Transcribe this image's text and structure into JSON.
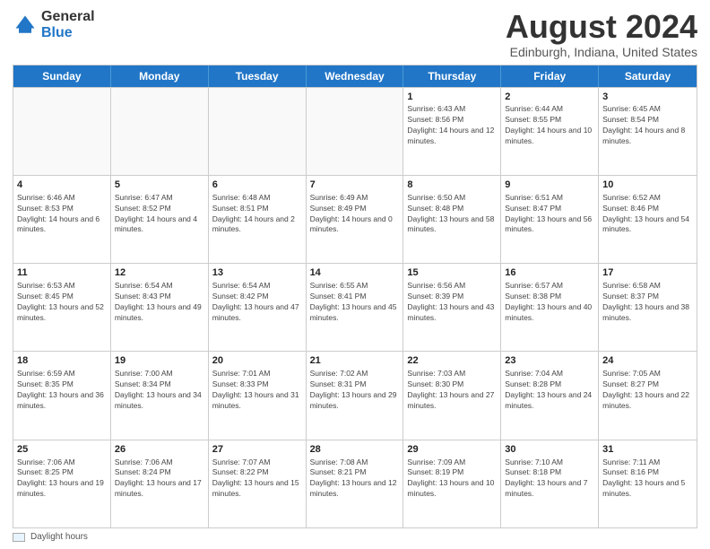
{
  "logo": {
    "general": "General",
    "blue": "Blue"
  },
  "title": "August 2024",
  "subtitle": "Edinburgh, Indiana, United States",
  "days_of_week": [
    "Sunday",
    "Monday",
    "Tuesday",
    "Wednesday",
    "Thursday",
    "Friday",
    "Saturday"
  ],
  "rows": [
    [
      {
        "day": "",
        "info": ""
      },
      {
        "day": "",
        "info": ""
      },
      {
        "day": "",
        "info": ""
      },
      {
        "day": "",
        "info": ""
      },
      {
        "day": "1",
        "info": "Sunrise: 6:43 AM\nSunset: 8:56 PM\nDaylight: 14 hours and 12 minutes."
      },
      {
        "day": "2",
        "info": "Sunrise: 6:44 AM\nSunset: 8:55 PM\nDaylight: 14 hours and 10 minutes."
      },
      {
        "day": "3",
        "info": "Sunrise: 6:45 AM\nSunset: 8:54 PM\nDaylight: 14 hours and 8 minutes."
      }
    ],
    [
      {
        "day": "4",
        "info": "Sunrise: 6:46 AM\nSunset: 8:53 PM\nDaylight: 14 hours and 6 minutes."
      },
      {
        "day": "5",
        "info": "Sunrise: 6:47 AM\nSunset: 8:52 PM\nDaylight: 14 hours and 4 minutes."
      },
      {
        "day": "6",
        "info": "Sunrise: 6:48 AM\nSunset: 8:51 PM\nDaylight: 14 hours and 2 minutes."
      },
      {
        "day": "7",
        "info": "Sunrise: 6:49 AM\nSunset: 8:49 PM\nDaylight: 14 hours and 0 minutes."
      },
      {
        "day": "8",
        "info": "Sunrise: 6:50 AM\nSunset: 8:48 PM\nDaylight: 13 hours and 58 minutes."
      },
      {
        "day": "9",
        "info": "Sunrise: 6:51 AM\nSunset: 8:47 PM\nDaylight: 13 hours and 56 minutes."
      },
      {
        "day": "10",
        "info": "Sunrise: 6:52 AM\nSunset: 8:46 PM\nDaylight: 13 hours and 54 minutes."
      }
    ],
    [
      {
        "day": "11",
        "info": "Sunrise: 6:53 AM\nSunset: 8:45 PM\nDaylight: 13 hours and 52 minutes."
      },
      {
        "day": "12",
        "info": "Sunrise: 6:54 AM\nSunset: 8:43 PM\nDaylight: 13 hours and 49 minutes."
      },
      {
        "day": "13",
        "info": "Sunrise: 6:54 AM\nSunset: 8:42 PM\nDaylight: 13 hours and 47 minutes."
      },
      {
        "day": "14",
        "info": "Sunrise: 6:55 AM\nSunset: 8:41 PM\nDaylight: 13 hours and 45 minutes."
      },
      {
        "day": "15",
        "info": "Sunrise: 6:56 AM\nSunset: 8:39 PM\nDaylight: 13 hours and 43 minutes."
      },
      {
        "day": "16",
        "info": "Sunrise: 6:57 AM\nSunset: 8:38 PM\nDaylight: 13 hours and 40 minutes."
      },
      {
        "day": "17",
        "info": "Sunrise: 6:58 AM\nSunset: 8:37 PM\nDaylight: 13 hours and 38 minutes."
      }
    ],
    [
      {
        "day": "18",
        "info": "Sunrise: 6:59 AM\nSunset: 8:35 PM\nDaylight: 13 hours and 36 minutes."
      },
      {
        "day": "19",
        "info": "Sunrise: 7:00 AM\nSunset: 8:34 PM\nDaylight: 13 hours and 34 minutes."
      },
      {
        "day": "20",
        "info": "Sunrise: 7:01 AM\nSunset: 8:33 PM\nDaylight: 13 hours and 31 minutes."
      },
      {
        "day": "21",
        "info": "Sunrise: 7:02 AM\nSunset: 8:31 PM\nDaylight: 13 hours and 29 minutes."
      },
      {
        "day": "22",
        "info": "Sunrise: 7:03 AM\nSunset: 8:30 PM\nDaylight: 13 hours and 27 minutes."
      },
      {
        "day": "23",
        "info": "Sunrise: 7:04 AM\nSunset: 8:28 PM\nDaylight: 13 hours and 24 minutes."
      },
      {
        "day": "24",
        "info": "Sunrise: 7:05 AM\nSunset: 8:27 PM\nDaylight: 13 hours and 22 minutes."
      }
    ],
    [
      {
        "day": "25",
        "info": "Sunrise: 7:06 AM\nSunset: 8:25 PM\nDaylight: 13 hours and 19 minutes."
      },
      {
        "day": "26",
        "info": "Sunrise: 7:06 AM\nSunset: 8:24 PM\nDaylight: 13 hours and 17 minutes."
      },
      {
        "day": "27",
        "info": "Sunrise: 7:07 AM\nSunset: 8:22 PM\nDaylight: 13 hours and 15 minutes."
      },
      {
        "day": "28",
        "info": "Sunrise: 7:08 AM\nSunset: 8:21 PM\nDaylight: 13 hours and 12 minutes."
      },
      {
        "day": "29",
        "info": "Sunrise: 7:09 AM\nSunset: 8:19 PM\nDaylight: 13 hours and 10 minutes."
      },
      {
        "day": "30",
        "info": "Sunrise: 7:10 AM\nSunset: 8:18 PM\nDaylight: 13 hours and 7 minutes."
      },
      {
        "day": "31",
        "info": "Sunrise: 7:11 AM\nSunset: 8:16 PM\nDaylight: 13 hours and 5 minutes."
      }
    ]
  ],
  "footer": {
    "legend_label": "Daylight hours"
  }
}
